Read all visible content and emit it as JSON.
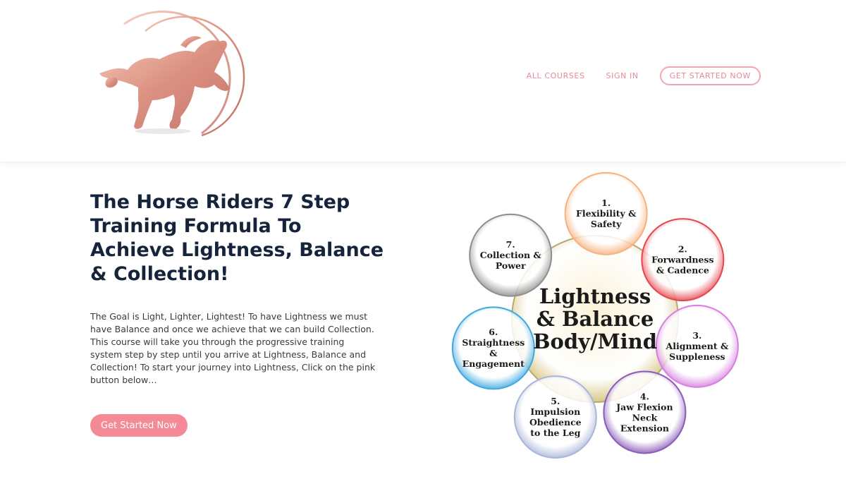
{
  "nav": {
    "all_courses": "ALL COURSES",
    "sign_in": "SIGN IN",
    "get_started": "GET STARTED NOW"
  },
  "hero": {
    "title": "The Horse Riders 7 Step Training Formula To Achieve Lightness, Balance & Collection!",
    "body": "The Goal is Light, Lighter, Lightest! To have Lightness we must have Balance and once we achieve that we can build Collection. This course will take you through the progressive training system step by step until you arrive at Lightness, Balance and Collection! To start your journey into Lightness, Click on the pink button below…",
    "button": "Get Started Now"
  },
  "diagram": {
    "center": [
      "Lightness",
      "& Balance",
      "Body/Mind"
    ],
    "steps": [
      {
        "lines": [
          "1.",
          "Flexibility &",
          "Safety"
        ],
        "color": "#f7b27e"
      },
      {
        "lines": [
          "2.",
          "Forwardness",
          "& Cadence"
        ],
        "color": "#e7474f"
      },
      {
        "lines": [
          "3.",
          "Alignment &",
          "Suppleness"
        ],
        "color": "#d87fe0"
      },
      {
        "lines": [
          "4.",
          "Jaw Flexion",
          "Neck",
          "Extension"
        ],
        "color": "#8a5bb8"
      },
      {
        "lines": [
          "5.",
          "Impulsion",
          "Obedience",
          "to the Leg"
        ],
        "color": "#a9b6d8"
      },
      {
        "lines": [
          "6.",
          "Straightness",
          "&",
          "Engagement"
        ],
        "color": "#3fa9e0"
      },
      {
        "lines": [
          "7.",
          "Collection &",
          "Power"
        ],
        "color": "#8f8f8f"
      }
    ]
  },
  "colors": {
    "accent": "#f48a95",
    "nav_text": "#e58a98",
    "title": "#15243a"
  }
}
